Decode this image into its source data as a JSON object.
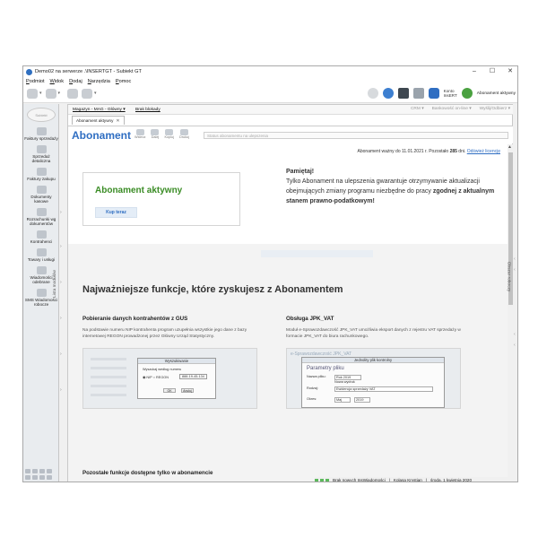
{
  "window": {
    "title": "Demo02 na serwerze .\\INSERTGT - Subiekt GT",
    "controls": [
      "–",
      "☐",
      "✕"
    ]
  },
  "menu": [
    "Podmiot",
    "Widok",
    "Dodaj",
    "Narzędzia",
    "Pomoc"
  ],
  "toolbar": {
    "konto_line1": "Konto",
    "konto_line2": "InsERT",
    "abonament_label": "Abonament aktywny"
  },
  "sidebar": {
    "logo": "Subiekt",
    "items": [
      {
        "label": "Faktury sprzedaży"
      },
      {
        "label": "Sprzedaż detaliczna"
      },
      {
        "label": "Faktury zakupu"
      },
      {
        "label": "Dokumenty kasowe"
      },
      {
        "label": "Rozrachunki wg dokumentów"
      },
      {
        "label": "Kontrahenci"
      },
      {
        "label": "Towary i usługi"
      },
      {
        "label": "Wiadomości odebrane"
      },
      {
        "label": "SMS Wiadomości robocze"
      }
    ],
    "lista_modulow": "Lista modułów"
  },
  "subbar": {
    "magazyn": "Magazyn - MAG - Główny ▾",
    "blokady": "Brak blokady",
    "crm": "CRM ▾",
    "bank": "Bankowość on-line ▾",
    "wyslij": "Wyślij/Odbierz ▾"
  },
  "doc_tab": {
    "label": "Abonament aktywny",
    "close": "✕"
  },
  "header": {
    "title": "Abonament",
    "nav": [
      "Wstecz",
      "Dalej",
      "Kopiuj",
      "Drukuj"
    ],
    "status_placeholder": "Status abonamentu na ulepszenia"
  },
  "license": {
    "text_before": "Abonament ważny do 11.01.2021 r. Pozostało ",
    "days": "285",
    "text_after": " dni. ",
    "link": "Odśwież licencję"
  },
  "active_box": {
    "heading": "Abonament aktywny",
    "buy_button": "Kup teraz"
  },
  "reminder": {
    "heading": "Pamiętaj!",
    "body_before": "Tylko Abonament na ulepszenia gwarantuje otrzymywanie aktualizacji obejmujących zmiany programu niezbędne do pracy ",
    "body_bold": "zgodnej z aktualnym stanem prawno-podatkowym!"
  },
  "features": {
    "section_title": "Najważniejsze funkcje, które zyskujesz z Abonamentem",
    "gus": {
      "title": "Pobieranie danych kontrahentów z GUS",
      "desc": "Na podstawie numeru NIP kontrahenta program uzupełnia wszystkie jego dane z bazy internetowej REGON prowadzonej przez Główny Urząd Statystyczny.",
      "dialog_title": "Wyszukiwanie",
      "dialog_caption": "Wyszukaj według numeru",
      "nip": "NIP",
      "regon": "REGON",
      "number": "888-19-45-134",
      "ok": "OK",
      "cancel": "Anuluj"
    },
    "jpk": {
      "title": "Obsługa JPK_VAT",
      "desc": "Moduł e-Sprawozdawczość JPK_VAT umożliwia eksport danych z rejestru VAT sprzedaży w formacie JPK_VAT do biura rachunkowego.",
      "bg_title": "e-Sprawozdawczość JPK_VAT",
      "dialog_title": "Jednolity plik kontrolny",
      "params": "Parametry pliku",
      "rows": [
        "Nazwa pliku:",
        "Rok 2019",
        "Nowa wydruk",
        "Rodzaj:",
        "Ewidencja sprzedaży VAT",
        "Okres:",
        "Maj",
        "2019"
      ]
    },
    "other_title": "Pozostałe funkcje dostępne tylko w abonamencie"
  },
  "right_panel": {
    "label": "Obszar roboczy"
  },
  "statusbar": {
    "messages": "Brak nowych InsWiadomości",
    "user": "Kolasa Krystian",
    "date": "środa, 1 kwietnia 2020"
  }
}
